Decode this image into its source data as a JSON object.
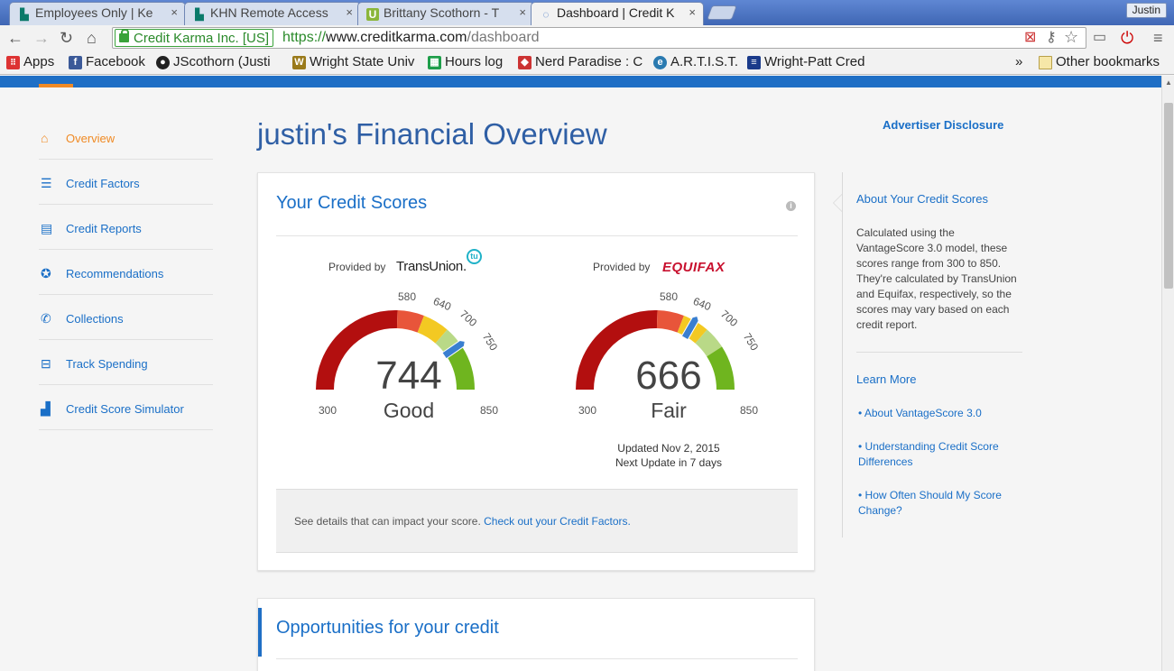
{
  "browser": {
    "tabs": [
      {
        "title": "Employees Only | Ke",
        "favicon": "k-logo-icon",
        "close": "×"
      },
      {
        "title": "KHN Remote Access",
        "favicon": "k-logo-icon",
        "close": "×"
      },
      {
        "title": "Brittany Scothorn - T",
        "favicon": "u-logo-icon",
        "close": "×"
      },
      {
        "title": "Dashboard | Credit K",
        "favicon": "loading-icon",
        "close": "×"
      }
    ],
    "profile": "Justin",
    "ev_cert": "Credit Karma Inc. [US]",
    "url_scheme": "https://",
    "url_host": "www.creditkarma.com",
    "url_path": "/dashboard",
    "bookmarks": [
      {
        "label": "Apps",
        "icon": "apps-grid-icon",
        "color": "#d33"
      },
      {
        "label": "Facebook",
        "icon": "facebook-icon",
        "color": "#3b5998"
      },
      {
        "label": "JScothorn (Justi",
        "icon": "github-icon",
        "color": "#222"
      },
      {
        "label": "Wright State Univ",
        "icon": "wsu-icon",
        "color": "#9a7a1a"
      },
      {
        "label": "Hours log",
        "icon": "sheets-icon",
        "color": "#1e9e4a"
      },
      {
        "label": "Nerd Paradise : C",
        "icon": "cube-icon",
        "color": "#c33"
      },
      {
        "label": "A.R.T.I.S.T.",
        "icon": "artist-icon",
        "color": "#2a7ab0"
      },
      {
        "label": "Wright-Patt Cred",
        "icon": "wpcu-icon",
        "color": "#1a3a8a"
      }
    ],
    "overflow": "»",
    "other_bookmarks": "Other bookmarks"
  },
  "sidebar": {
    "items": [
      {
        "label": "Overview",
        "icon": "home-icon",
        "glyph": "⌂",
        "active": true
      },
      {
        "label": "Credit Factors",
        "icon": "checklist-icon",
        "glyph": "☰",
        "active": false
      },
      {
        "label": "Credit Reports",
        "icon": "document-icon",
        "glyph": "▤",
        "active": false
      },
      {
        "label": "Recommendations",
        "icon": "ribbon-icon",
        "glyph": "✪",
        "active": false
      },
      {
        "label": "Collections",
        "icon": "phone-icon",
        "glyph": "✆",
        "active": false
      },
      {
        "label": "Track Spending",
        "icon": "money-icon",
        "glyph": "⊟",
        "active": false
      },
      {
        "label": "Credit Score Simulator",
        "icon": "chart-icon",
        "glyph": "▟",
        "active": false
      }
    ]
  },
  "page": {
    "title": "justin's Financial Overview",
    "advertiser": "Advertiser Disclosure"
  },
  "scores_card": {
    "title": "Your Credit Scores",
    "info": "i",
    "transunion": {
      "provided_by": "Provided by",
      "brand": "TransUnion.",
      "badge": "tu",
      "score": "744",
      "score_value": 744,
      "rating": "Good",
      "min": "300",
      "max": "850",
      "ticks": [
        "580",
        "640",
        "700",
        "750"
      ]
    },
    "equifax": {
      "provided_by": "Provided by",
      "brand": "EQUIFAX",
      "score": "666",
      "score_value": 666,
      "rating": "Fair",
      "min": "300",
      "max": "850",
      "ticks": [
        "580",
        "640",
        "700",
        "750"
      ]
    },
    "updated": "Updated Nov 2, 2015",
    "next_update": "Next Update in 7 days",
    "notice_text": "See details that can impact your score.",
    "notice_link": "Check out your Credit Factors."
  },
  "right_panel": {
    "heading": "About Your Credit Scores",
    "body": "Calculated using the VantageScore 3.0 model, these scores range from 300 to 850. They're calculated by TransUnion and Equifax, respectively, so the scores may vary based on each credit report.",
    "learn_more": "Learn More",
    "links": [
      "• About VantageScore 3.0",
      "• Understanding Credit Score Differences",
      "• How Often Should My Score Change?"
    ]
  },
  "opportunities": {
    "title": "Opportunities for your credit"
  },
  "colors": {
    "accent_blue": "#1a6fc7",
    "accent_orange": "#f08a24",
    "gauge_red": "#b30f0f",
    "gauge_orange": "#e8553a",
    "gauge_yellow": "#f3c922",
    "gauge_lightgreen": "#b9d987",
    "gauge_green": "#6fb51f"
  }
}
